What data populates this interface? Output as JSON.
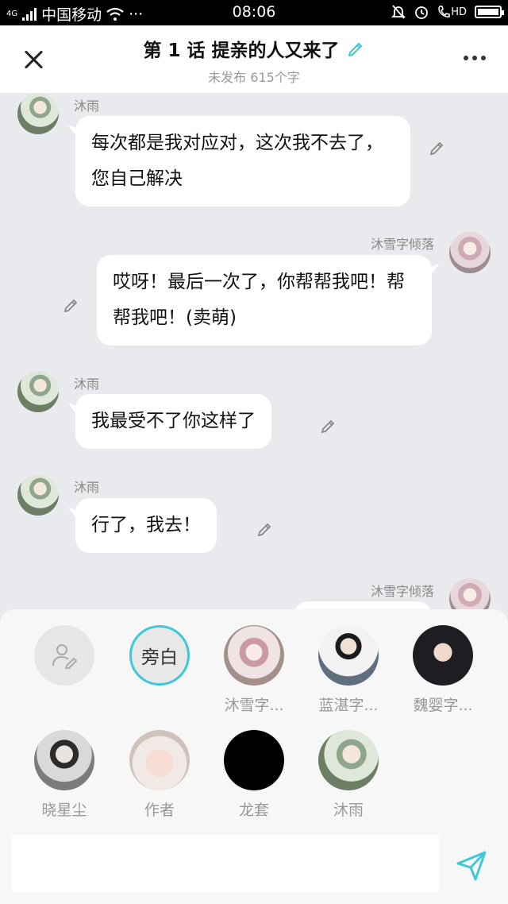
{
  "status_bar": {
    "network": "4G",
    "carrier": "中国移动",
    "dots": "···",
    "time": "08:06",
    "hd": "HD"
  },
  "header": {
    "title": "第 1 话 提亲的人又来了",
    "subtitle": "未发布 615个字"
  },
  "messages": [
    {
      "sender": "沐雨",
      "side": "left",
      "text": "每次都是我对应对，这次我不去了，您自己解决"
    },
    {
      "sender": "沐雪字倾落",
      "side": "right",
      "text": "哎呀！最后一次了，你帮帮我吧！帮帮我吧！(卖萌)"
    },
    {
      "sender": "沐雨",
      "side": "left",
      "text": "我最受不了你这样了"
    },
    {
      "sender": "沐雨",
      "side": "left",
      "text": "行了，我去！"
    },
    {
      "sender": "沐雪字倾落",
      "side": "right",
      "text": ""
    }
  ],
  "roles": {
    "narrator_label": "旁白",
    "items": [
      {
        "name": "沐雪字..."
      },
      {
        "name": "蓝湛字..."
      },
      {
        "name": "魏婴字..."
      },
      {
        "name": "晓星尘"
      },
      {
        "name": "作者"
      },
      {
        "name": "龙套"
      },
      {
        "name": "沐雨"
      }
    ]
  },
  "composer": {
    "input_value": "",
    "placeholder": ""
  },
  "colors": {
    "accent": "#3fc8d6",
    "chat_background": "#e9eaee"
  }
}
